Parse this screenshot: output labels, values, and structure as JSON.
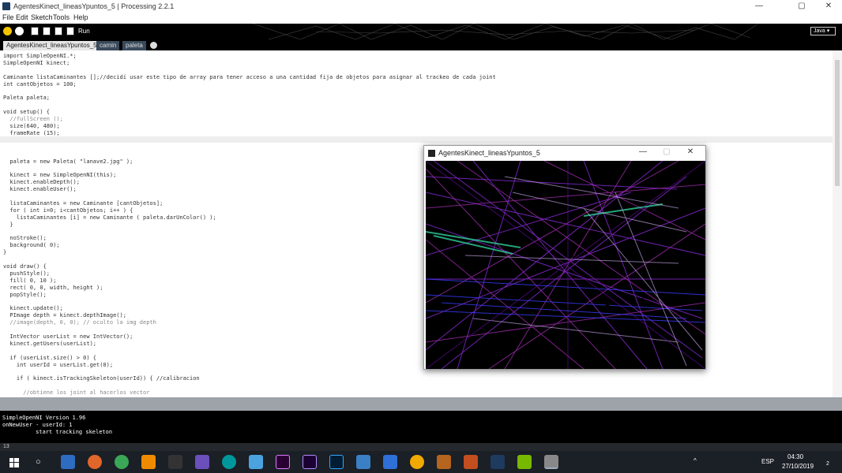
{
  "window": {
    "title": "AgentesKinect_lineasYpuntos_5 | Processing 2.2.1",
    "minimize": "—",
    "maximize": "▢",
    "close": "✕"
  },
  "menu": [
    "File",
    "Edit",
    "Sketch",
    "Tools",
    "Help"
  ],
  "toolbar": {
    "run_label": "Run",
    "mode": "Java ▾"
  },
  "tabs": [
    "AgentesKinect_lineasYpuntos_5",
    "camin",
    "paleta"
  ],
  "code": [
    "import SimpleOpenNI.*;",
    "SimpleOpenNI kinect;",
    "",
    "Caminante listaCaminantes [];//decidí usar este tipo de array para tener acceso a una cantidad fija de objetos para asignar al trackeo de cada joint",
    "int cantObjetos = 100;",
    "",
    "Paleta paleta;",
    "",
    "void setup() {",
    "  //fullScreen ();",
    "  size(640, 480);",
    "  frameRate (15);",
    "",
    "",
    "",
    "  paleta = new Paleta( \"lanave2.jpg\" );",
    "",
    "  kinect = new SimpleOpenNI(this);",
    "  kinect.enableDepth();",
    "  kinect.enableUser();",
    "",
    "  listaCaminantes = new Caminante [cantObjetos];",
    "  for ( int i=0; i<cantObjetos; i++ ) {",
    "    listaCaminantes [i] = new Caminante ( paleta.darUnColor() );",
    "  }",
    "",
    "  noStroke();",
    "  background( 0);",
    "}",
    "",
    "void draw() {",
    "  pushStyle();",
    "  fill( 0, 10 );",
    "  rect( 0, 0, width, height );",
    "  popStyle();",
    "",
    "  kinect.update();",
    "  PImage depth = kinect.depthImage();",
    "  //image(depth, 0, 0); // oculto la img depth",
    "",
    "  IntVector userList = new IntVector();",
    "  kinect.getUsers(userList);",
    "",
    "  if (userList.size() > 0) {",
    "    int userId = userList.get(0);",
    "",
    "    if ( kinect.isTrackingSkeleton(userId)) { //calibracion",
    "",
    "      //obtiene los joint al hacerlos vector"
  ],
  "console": [
    "SimpleOpenNI Version 1.96",
    "onNewUser - userId: 1",
    "          start tracking skeleton"
  ],
  "status": {
    "line": "13"
  },
  "sketch_window": {
    "title": "AgentesKinect_lineasYpuntos_5"
  },
  "taskbar": {
    "lang": "ESP",
    "time": "04:30",
    "date": "27/10/2019",
    "notif": "2"
  }
}
